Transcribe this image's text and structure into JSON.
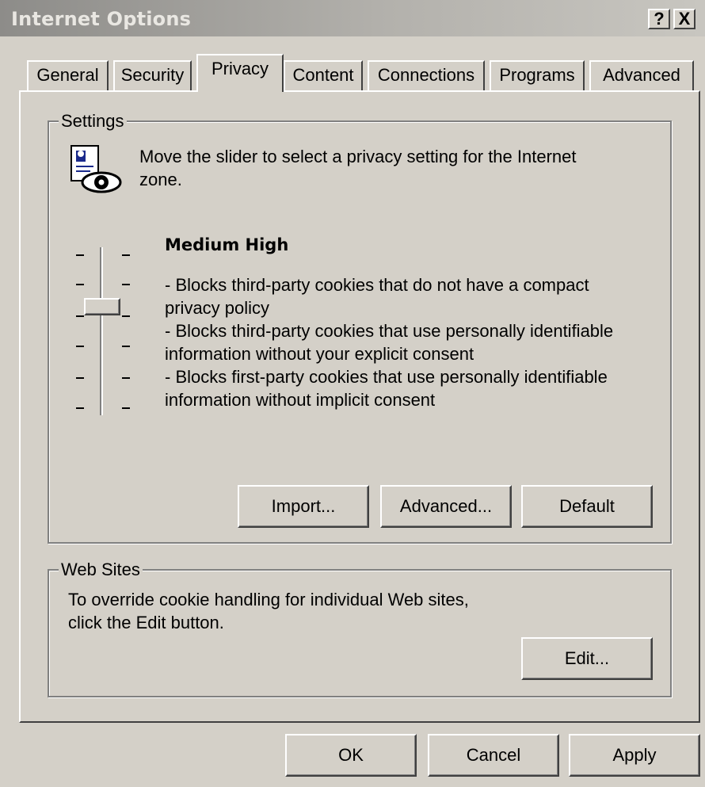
{
  "window": {
    "title": "Internet Options",
    "help_button": "?",
    "close_button": "X"
  },
  "tabs": [
    {
      "label": "General",
      "active": false
    },
    {
      "label": "Security",
      "active": false
    },
    {
      "label": "Privacy",
      "active": true
    },
    {
      "label": "Content",
      "active": false
    },
    {
      "label": "Connections",
      "active": false
    },
    {
      "label": "Programs",
      "active": false
    },
    {
      "label": "Advanced",
      "active": false
    }
  ],
  "settings": {
    "group_label": "Settings",
    "instruction_line1": "Move the slider to select a privacy setting for the Internet",
    "instruction_line2": "zone.",
    "slider": {
      "levels": 6,
      "selected_index_from_top": 2
    },
    "level_name": "Medium High",
    "description": [
      "- Blocks third-party cookies that do not have a compact",
      "privacy policy",
      "- Blocks third-party cookies that use personally identifiable",
      "information without your explicit consent",
      "- Blocks first-party cookies that use personally identifiable",
      "information without implicit consent"
    ],
    "buttons": {
      "import": "Import...",
      "advanced": "Advanced...",
      "default": "Default"
    }
  },
  "web_sites": {
    "group_label": "Web Sites",
    "line1": "To override cookie handling for individual Web sites,",
    "line2": "click the Edit button.",
    "edit_button": "Edit..."
  },
  "footer": {
    "ok": "OK",
    "cancel": "Cancel",
    "apply": "Apply"
  }
}
